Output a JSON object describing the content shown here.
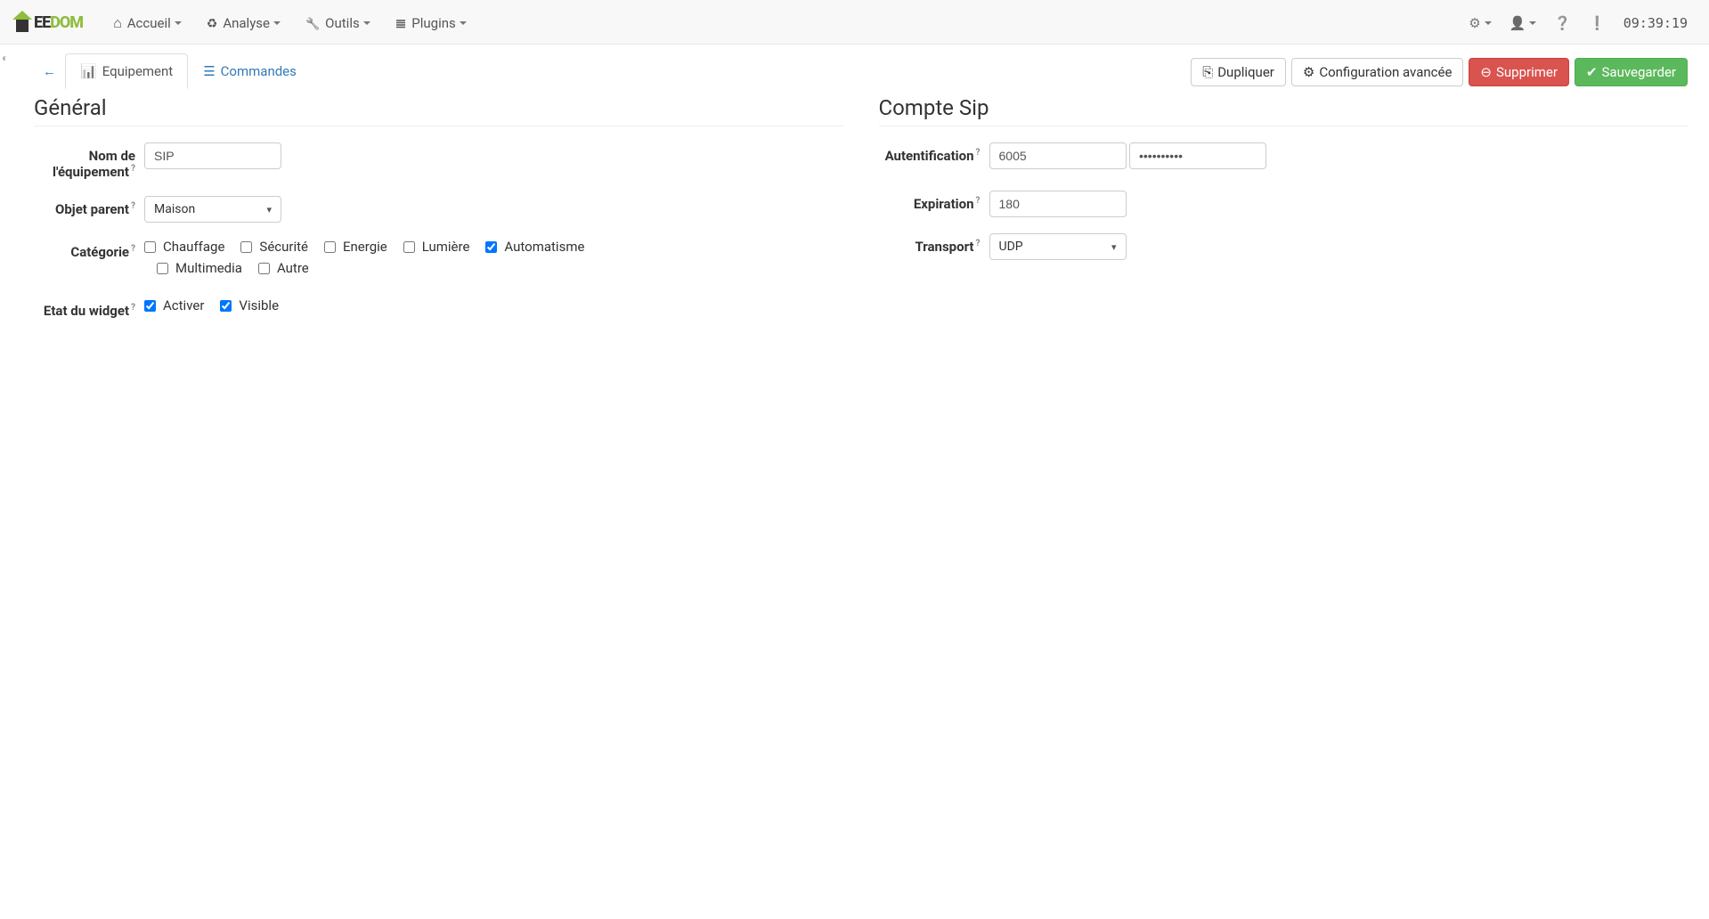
{
  "navbar": {
    "logo_text1": "EE",
    "logo_text2": "DOM",
    "items": [
      {
        "label": "Accueil",
        "icon": "i-home"
      },
      {
        "label": "Analyse",
        "icon": "i-analyse"
      },
      {
        "label": "Outils",
        "icon": "i-wrench"
      },
      {
        "label": "Plugins",
        "icon": "i-plugins"
      }
    ],
    "clock": "09:39:19"
  },
  "tabs": {
    "equipement": "Equipement",
    "commandes": "Commandes"
  },
  "actions": {
    "dupliquer": "Dupliquer",
    "config": "Configuration avancée",
    "supprimer": "Supprimer",
    "sauvegarder": "Sauvegarder"
  },
  "general": {
    "title": "Général",
    "name_label": "Nom de l'équipement",
    "name_value": "SIP",
    "parent_label": "Objet parent",
    "parent_value": "Maison",
    "category_label": "Catégorie",
    "categories": [
      {
        "label": "Chauffage",
        "checked": false
      },
      {
        "label": "Sécurité",
        "checked": false
      },
      {
        "label": "Energie",
        "checked": false
      },
      {
        "label": "Lumière",
        "checked": false
      },
      {
        "label": "Automatisme",
        "checked": true
      },
      {
        "label": "Multimedia",
        "checked": false
      },
      {
        "label": "Autre",
        "checked": false
      }
    ],
    "state_label": "Etat du widget",
    "states": [
      {
        "label": "Activer",
        "checked": true
      },
      {
        "label": "Visible",
        "checked": true
      }
    ]
  },
  "sip": {
    "title": "Compte Sip",
    "auth_label": "Autentification",
    "auth_user": "6005",
    "auth_pass": "••••••••••",
    "exp_label": "Expiration",
    "exp_value": "180",
    "transport_label": "Transport",
    "transport_value": "UDP"
  }
}
